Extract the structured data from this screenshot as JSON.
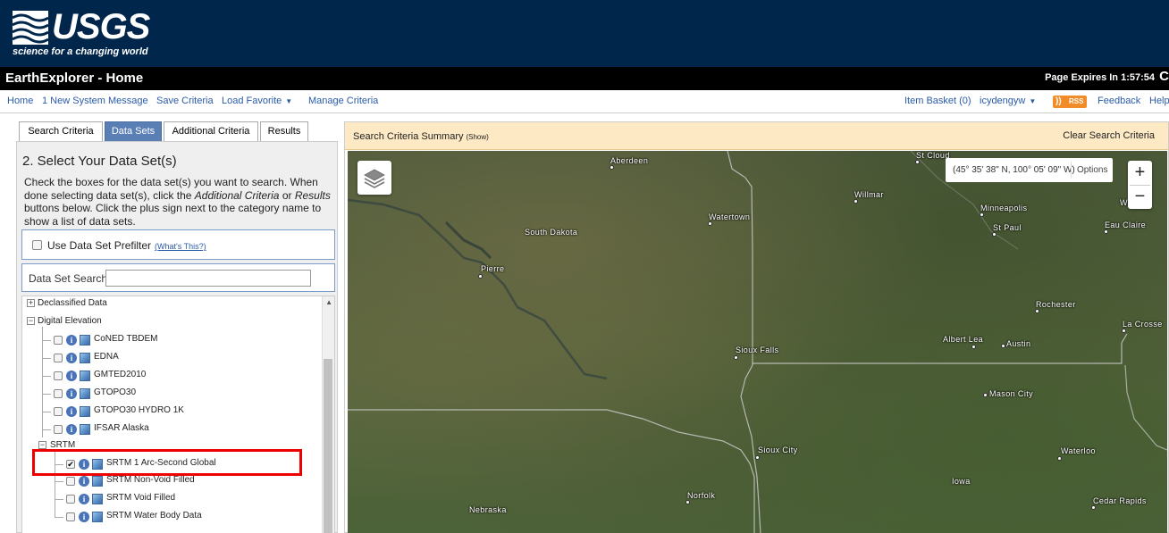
{
  "header": {
    "logo_text": "USGS",
    "logo_tagline": "science for a changing world",
    "app_title": "EarthExplorer - Home",
    "expires": "Page Expires In 1:57:54"
  },
  "nav": {
    "home": "Home",
    "message": "1 New System Message",
    "save_criteria": "Save Criteria",
    "load_favorite": "Load Favorite",
    "manage_criteria": "Manage Criteria",
    "item_basket": "Item Basket (0)",
    "user": "icydengyw",
    "rss": "RSS",
    "feedback": "Feedback",
    "help": "Help"
  },
  "tabs": [
    "Search Criteria",
    "Data Sets",
    "Additional Criteria",
    "Results"
  ],
  "active_tab": "Data Sets",
  "section": {
    "title": "2. Select Your Data Set(s)",
    "instr_1": "Check the boxes for the data set(s) you want to search. When done selecting data set(s), click the ",
    "instr_em1": "Additional Criteria",
    "instr_2": " or ",
    "instr_em2": "Results",
    "instr_3": " buttons below. Click the plus sign next to the category name to show a list of data sets."
  },
  "prefilter": {
    "label": "Use Data Set Prefilter",
    "link": "(What's This?)"
  },
  "search": {
    "label": "Data Set Search:",
    "value": ""
  },
  "tree": {
    "declassified": "Declassified Data",
    "digital_elevation": "Digital Elevation",
    "items": [
      "CoNED TBDEM",
      "EDNA",
      "GMTED2010",
      "GTOPO30",
      "GTOPO30 HYDRO 1K",
      "IFSAR Alaska"
    ],
    "srtm": "SRTM",
    "srtm_items": [
      {
        "label": "SRTM 1 Arc-Second Global",
        "checked": true
      },
      {
        "label": "SRTM Non-Void Filled",
        "checked": false
      },
      {
        "label": "SRTM Void Filled",
        "checked": false
      },
      {
        "label": "SRTM Water Body Data",
        "checked": false
      }
    ]
  },
  "map": {
    "summary_title": "Search Criteria Summary",
    "summary_show": "(Show)",
    "clear": "Clear Search Criteria",
    "coords": "(45° 35' 38\" N, 100° 05' 09\" W)",
    "options": "Options",
    "zoom_in": "+",
    "zoom_out": "−",
    "cities": {
      "st_cloud": "St Cloud",
      "aberdeen": "Aberdeen",
      "willmar": "Willmar",
      "watertown": "Watertown",
      "minneapolis": "Minneapolis",
      "wisconsin": "Wisc",
      "st_paul": "St Paul",
      "eau_claire": "Eau Claire",
      "south_dakota": "South Dakota",
      "pierre": "Pierre",
      "rochester": "Rochester",
      "la_crosse": "La Crosse",
      "sioux_falls": "Sioux Falls",
      "albert_lea": "Albert Lea",
      "austin": "Austin",
      "mason_city": "Mason City",
      "sioux_city": "Sioux City",
      "waterloo": "Waterloo",
      "iowa": "Iowa",
      "norfolk": "Norfolk",
      "nebraska": "Nebraska",
      "cedar_rapids": "Cedar Rapids"
    }
  },
  "colors": {
    "header_bg": "#00264c",
    "title_bar_bg": "#000000",
    "tab_active": "#5a7fb5",
    "link": "#2a5ba8",
    "criteria_bar": "#fde9c4",
    "highlight": "#e00000"
  }
}
